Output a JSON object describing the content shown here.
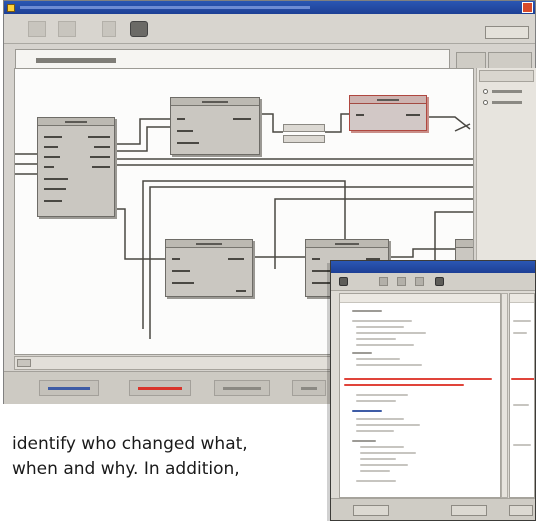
{
  "main_window": {
    "title": "",
    "side_panel": {
      "header": "",
      "items": [
        "",
        ""
      ]
    },
    "active_tab": "",
    "inactive_tabs": [
      "",
      ""
    ],
    "status_tabs": [
      "",
      "",
      "",
      ""
    ],
    "colors": {
      "title_bar": "#1d3f95",
      "highlight_block": "#b0473f",
      "status_tab_blue": "#3e5ca6",
      "status_tab_red": "#d9342a"
    }
  },
  "inset_window": {
    "title": "",
    "colors": {
      "diff_removed": "#e0443a",
      "diff_added": "#3e5ca6"
    }
  },
  "body_copy": {
    "line_1": "identify who changed what,",
    "line_2": "when and why. In addition,"
  }
}
